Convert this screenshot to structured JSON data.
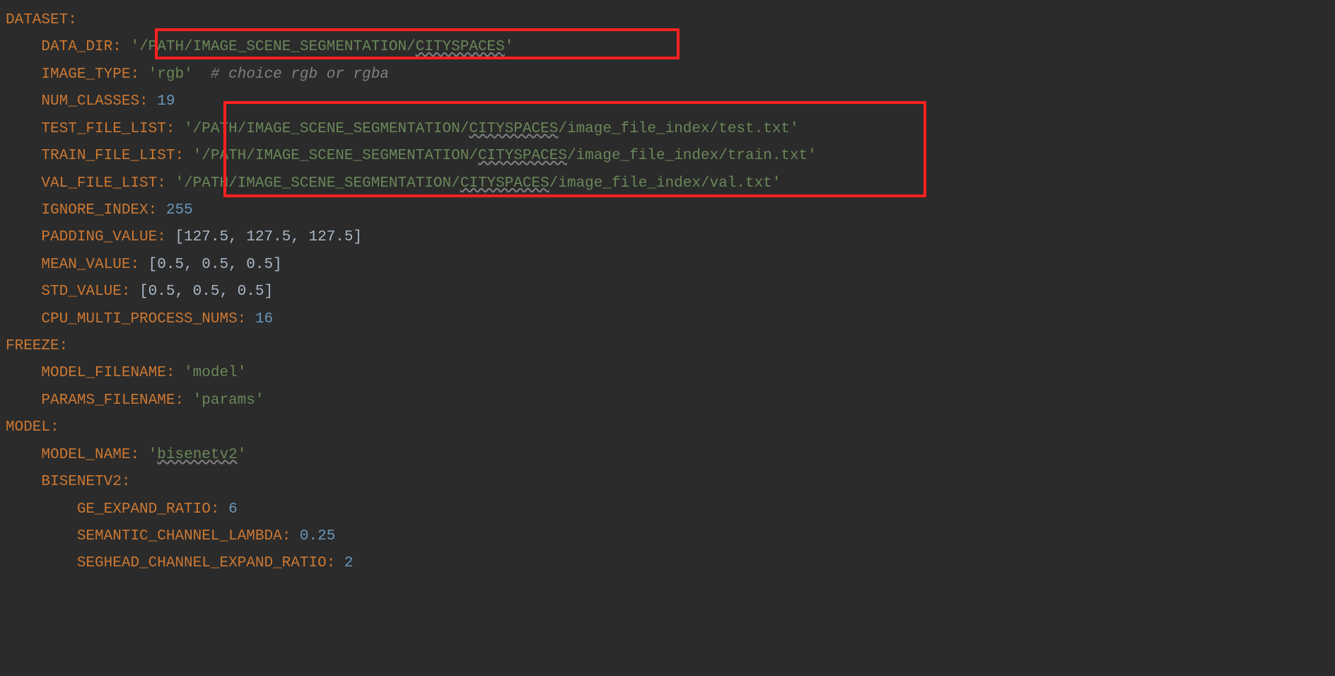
{
  "code": {
    "dataset": "DATASET",
    "data_dir": "DATA_DIR",
    "data_dir_val_pre": "'/PATH/IMAGE_SCENE_SEGMENTATION/",
    "data_dir_val_wavy": "CITYSPACES",
    "data_dir_val_post": "'",
    "image_type": "IMAGE_TYPE",
    "image_type_val": "'rgb'",
    "image_type_comment": "# choice rgb or rgba",
    "num_classes": "NUM_CLASSES",
    "num_classes_val": "19",
    "test_file_list": "TEST_FILE_LIST",
    "test_val_pre": "'/PATH/IMAGE_SCENE_SEGMENTATION/",
    "test_val_wavy": "CITYSPACES",
    "test_val_post": "/image_file_index/test.txt'",
    "train_file_list": "TRAIN_FILE_LIST",
    "train_val_pre": "'/PATH/IMAGE_SCENE_SEGMENTATION/",
    "train_val_wavy": "CITYSPACES",
    "train_val_post": "/image_file_index/train.txt'",
    "val_file_list": "VAL_FILE_LIST",
    "val_val_pre": "'/PATH/IMAGE_SCENE_SEGMENTATION/",
    "val_val_wavy": "CITYSPACES",
    "val_val_post": "/image_file_index/val.txt'",
    "ignore_index": "IGNORE_INDEX",
    "ignore_index_val": "255",
    "padding_value": "PADDING_VALUE",
    "padding_value_val": "[127.5, 127.5, 127.5]",
    "mean_value": "MEAN_VALUE",
    "mean_value_val": "[0.5, 0.5, 0.5]",
    "std_value": "STD_VALUE",
    "std_value_val": "[0.5, 0.5, 0.5]",
    "cpu_multi": "CPU_MULTI_PROCESS_NUMS",
    "cpu_multi_val": "16",
    "freeze": "FREEZE",
    "model_filename": "MODEL_FILENAME",
    "model_filename_val": "'model'",
    "params_filename": "PARAMS_FILENAME",
    "params_filename_val": "'params'",
    "model": "MODEL",
    "model_name": "MODEL_NAME",
    "model_name_val_pre": "'",
    "model_name_val_wavy": "bisenetv2",
    "model_name_val_post": "'",
    "bisenetv2": "BISENETV2",
    "ge_expand": "GE_EXPAND_RATIO",
    "ge_expand_val": "6",
    "semantic_lambda": "SEMANTIC_CHANNEL_LAMBDA",
    "semantic_lambda_val": "0.25",
    "seghead": "SEGHEAD_CHANNEL_EXPAND_RATIO",
    "seghead_val": "2"
  }
}
